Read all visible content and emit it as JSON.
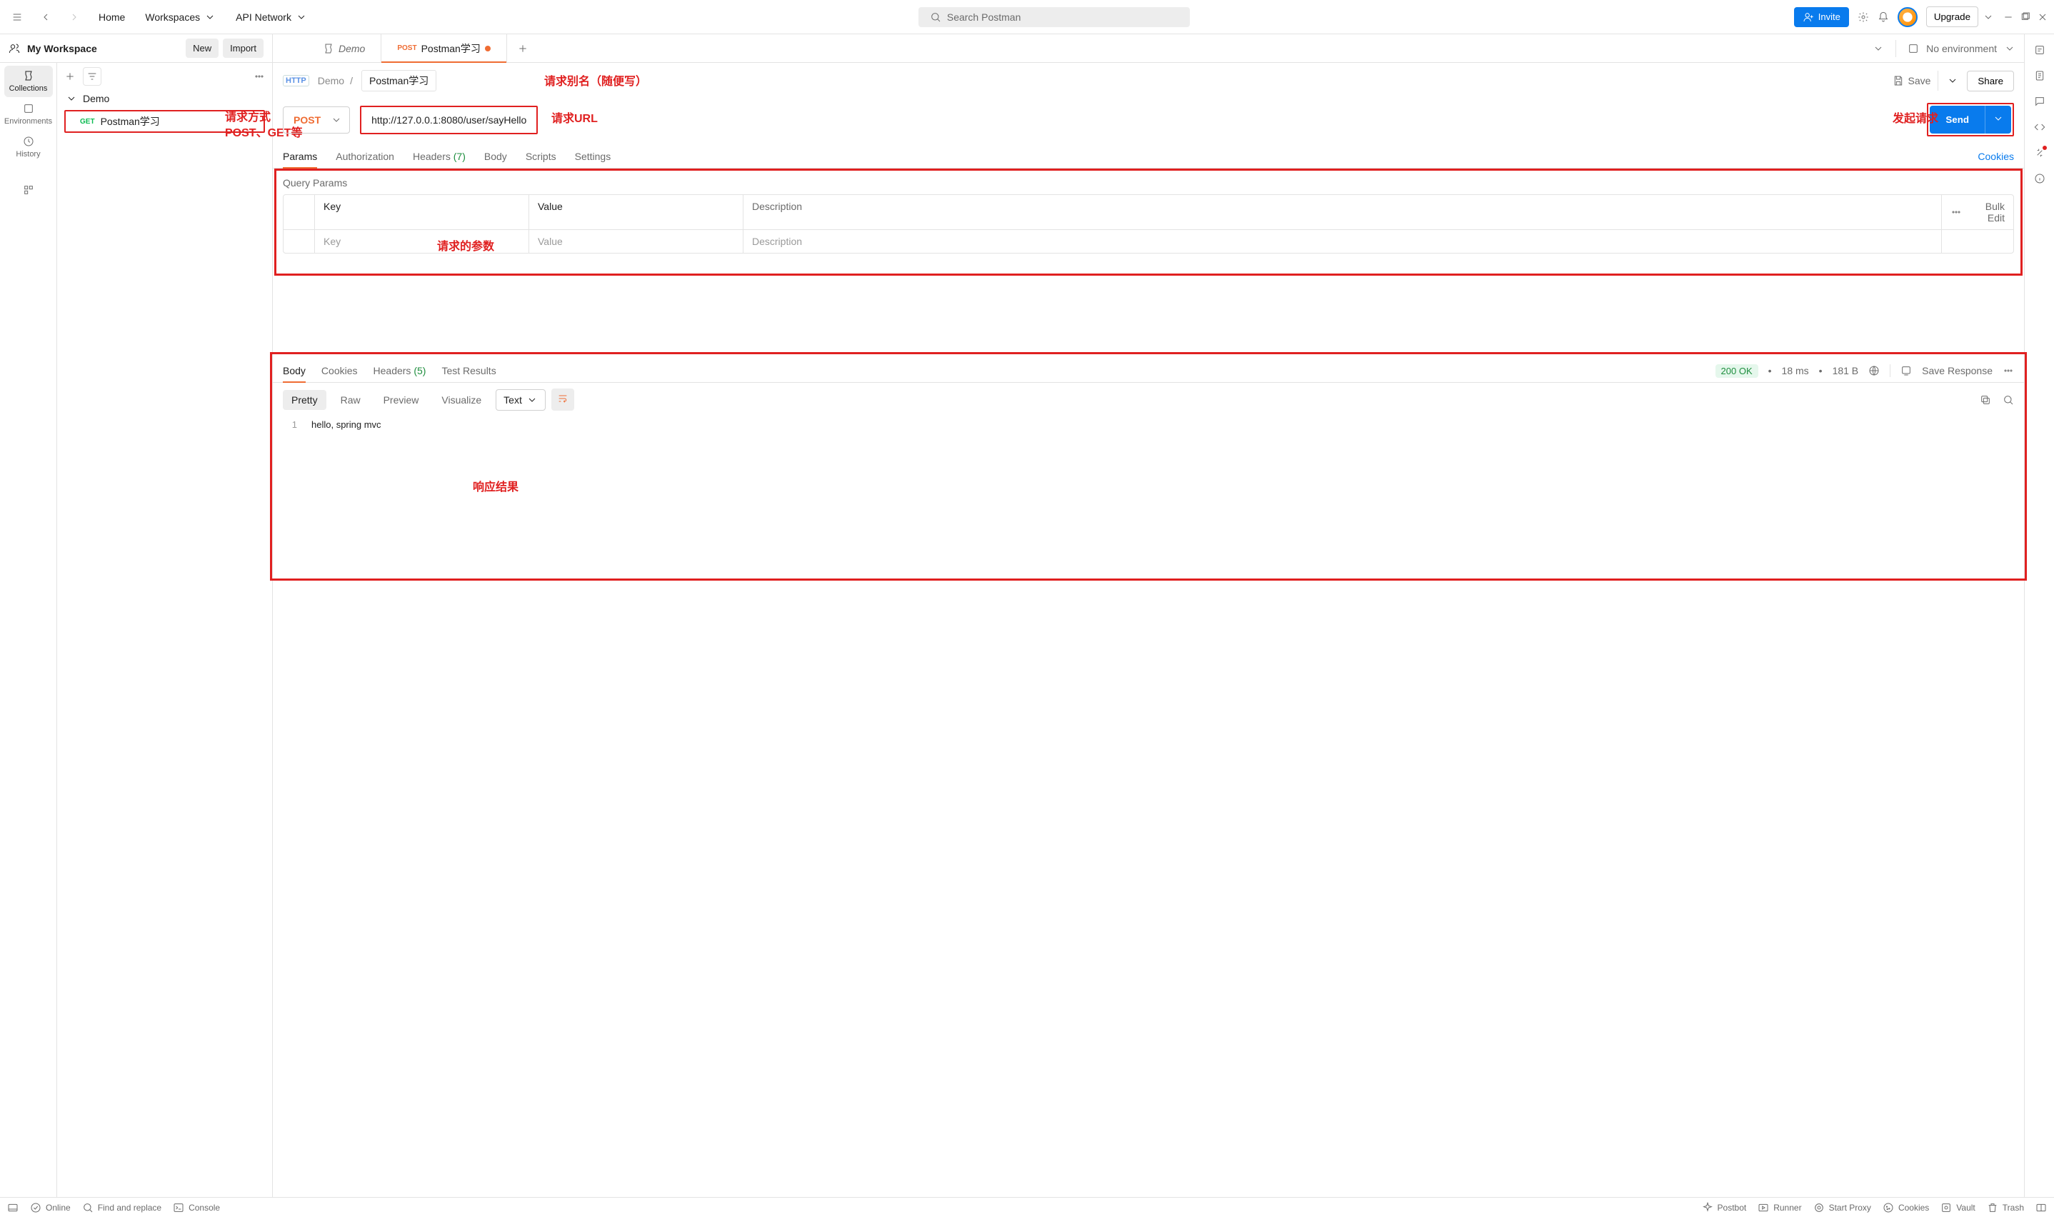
{
  "topbar": {
    "home": "Home",
    "workspaces": "Workspaces",
    "api_network": "API Network",
    "search_placeholder": "Search Postman",
    "invite": "Invite",
    "upgrade": "Upgrade"
  },
  "workspace": {
    "name": "My Workspace",
    "new": "New",
    "import": "Import"
  },
  "leftnav": {
    "collections": "Collections",
    "environments": "Environments",
    "history": "History"
  },
  "sidebar": {
    "folder": "Demo",
    "item_method": "GET",
    "item_name": "Postman学习"
  },
  "tabs": {
    "demo": "Demo",
    "active_method": "POST",
    "active_name": "Postman学习",
    "env": "No environment"
  },
  "request": {
    "proto": "HTTP",
    "folder": "Demo",
    "name": "Postman学习",
    "save": "Save",
    "share": "Share",
    "method": "POST",
    "url": "http://127.0.0.1:8080/user/sayHello",
    "send": "Send",
    "subtabs": {
      "params": "Params",
      "auth": "Authorization",
      "headers": "Headers",
      "headers_count": "(7)",
      "body": "Body",
      "scripts": "Scripts",
      "settings": "Settings",
      "cookies": "Cookies"
    },
    "qp": {
      "title": "Query Params",
      "key": "Key",
      "value": "Value",
      "desc": "Description",
      "bulk": "Bulk Edit",
      "ph_key": "Key",
      "ph_value": "Value",
      "ph_desc": "Description"
    }
  },
  "response": {
    "tabs": {
      "body": "Body",
      "cookies": "Cookies",
      "headers": "Headers",
      "headers_count": "(5)",
      "tests": "Test Results"
    },
    "status": "200 OK",
    "time": "18 ms",
    "size": "181 B",
    "save": "Save Response",
    "views": {
      "pretty": "Pretty",
      "raw": "Raw",
      "preview": "Preview",
      "visualize": "Visualize",
      "type": "Text"
    },
    "line_no": "1",
    "body_text": "hello, spring mvc"
  },
  "footer": {
    "online": "Online",
    "find": "Find and replace",
    "console": "Console",
    "postbot": "Postbot",
    "runner": "Runner",
    "proxy": "Start Proxy",
    "cookies": "Cookies",
    "vault": "Vault",
    "trash": "Trash"
  },
  "annotations": {
    "alias": "请求别名（随便写）",
    "method1": "请求方式",
    "method2": "POST、GET等",
    "url": "请求URL",
    "send": "发起请求",
    "params": "请求的参数",
    "resp": "响应结果"
  }
}
